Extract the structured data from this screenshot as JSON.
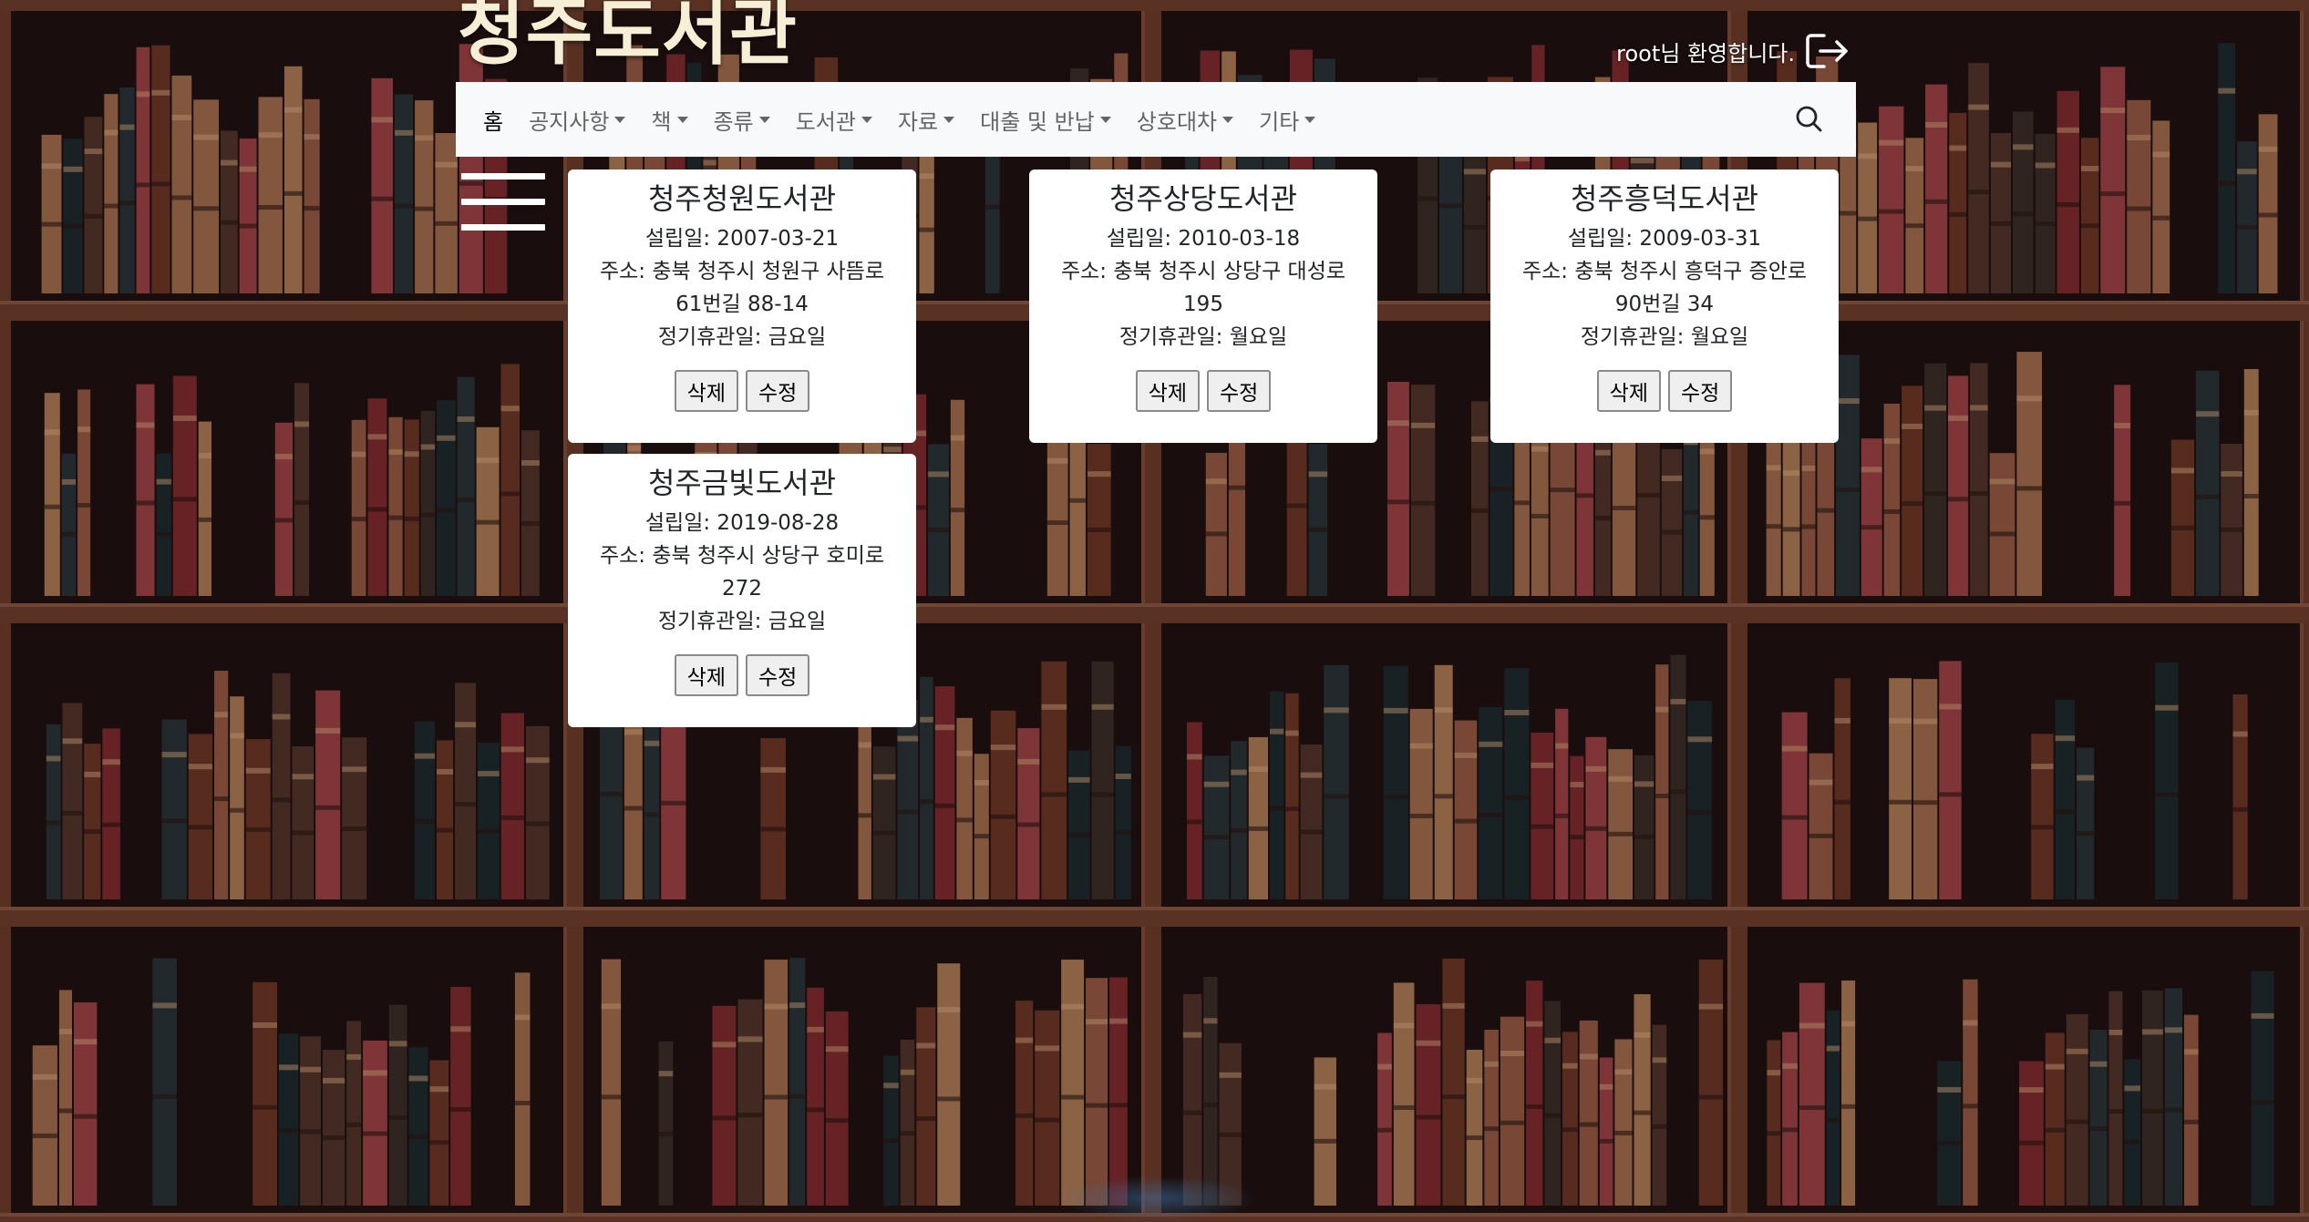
{
  "site": {
    "title": "청주도서관",
    "welcome_text": "root님 환영합니다."
  },
  "nav": {
    "items": [
      {
        "label": "홈",
        "dropdown": false,
        "active": true
      },
      {
        "label": "공지사항",
        "dropdown": true
      },
      {
        "label": "책",
        "dropdown": true
      },
      {
        "label": "종류",
        "dropdown": true
      },
      {
        "label": "도서관",
        "dropdown": true
      },
      {
        "label": "자료",
        "dropdown": true
      },
      {
        "label": "대출 및 반납",
        "dropdown": true
      },
      {
        "label": "상호대차",
        "dropdown": true
      },
      {
        "label": "기타",
        "dropdown": true
      }
    ],
    "search_icon": "search-icon"
  },
  "libraries": [
    {
      "name": "청주청원도서관",
      "established": "설립일: 2007-03-21",
      "address": "주소: 충북 청주시 청원구 사뜸로 61번길 88-14",
      "closed": "정기휴관일: 금요일",
      "delete_label": "삭제",
      "edit_label": "수정"
    },
    {
      "name": "청주상당도서관",
      "established": "설립일: 2010-03-18",
      "address": "주소: 충북 청주시 상당구 대성로 195",
      "closed": "정기휴관일: 월요일",
      "delete_label": "삭제",
      "edit_label": "수정"
    },
    {
      "name": "청주흥덕도서관",
      "established": "설립일: 2009-03-31",
      "address": "주소: 충북 청주시 흥덕구 증안로90번길 34",
      "closed": "정기휴관일: 월요일",
      "delete_label": "삭제",
      "edit_label": "수정"
    },
    {
      "name": "청주금빛도서관",
      "established": "설립일: 2019-08-28",
      "address": "주소: 충북 청주시 상당구 호미로 272",
      "closed": "정기휴관일: 금요일",
      "delete_label": "삭제",
      "edit_label": "수정"
    }
  ],
  "colors": {
    "title": "#f6efd5",
    "navbar_bg": "#f8f9fa",
    "card_bg": "#ffffff",
    "shelf_wood": "#6b3b2a"
  }
}
